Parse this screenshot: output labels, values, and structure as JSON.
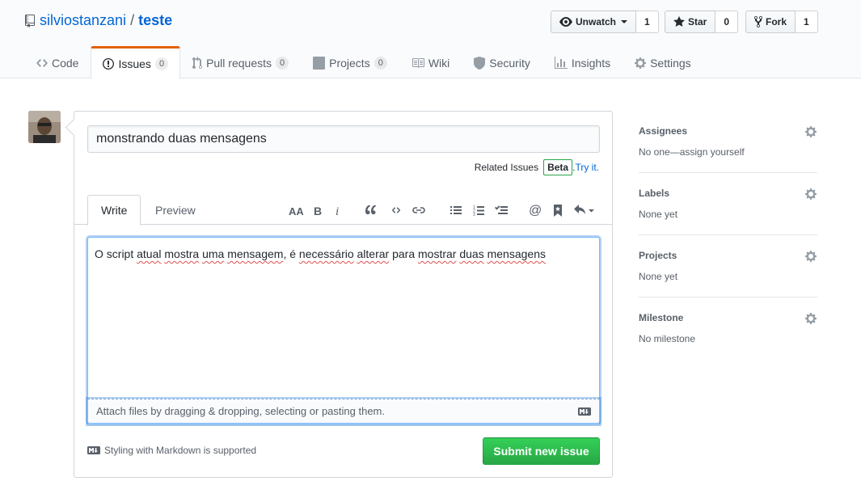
{
  "repo": {
    "owner": "silviostanzani",
    "separator": "/",
    "name": "teste"
  },
  "actions": {
    "watch": {
      "label": "Unwatch",
      "count": "1"
    },
    "star": {
      "label": "Star",
      "count": "0"
    },
    "fork": {
      "label": "Fork",
      "count": "1"
    }
  },
  "tabs": [
    {
      "label": "Code"
    },
    {
      "label": "Issues",
      "count": "0"
    },
    {
      "label": "Pull requests",
      "count": "0"
    },
    {
      "label": "Projects",
      "count": "0"
    },
    {
      "label": "Wiki"
    },
    {
      "label": "Security"
    },
    {
      "label": "Insights"
    },
    {
      "label": "Settings"
    }
  ],
  "form": {
    "title_value": "monstrando duas mensagens",
    "related_label": "Related Issues",
    "beta": "Beta",
    "dot": ".",
    "try_it": "Try it.",
    "write_tab": "Write",
    "preview_tab": "Preview",
    "body": [
      "O script ",
      "atual",
      " ",
      "mostra",
      " ",
      "uma",
      " ",
      "mensagem",
      ", é ",
      "necessário",
      " ",
      "alterar",
      " para ",
      "mostrar",
      " ",
      "duas",
      " ",
      "mensagens"
    ],
    "attach_hint": "Attach files by dragging & dropping, selecting or pasting them.",
    "markdown_note": "Styling with Markdown is supported",
    "submit": "Submit new issue"
  },
  "sidebar": [
    {
      "title": "Assignees",
      "value": "No one—assign yourself"
    },
    {
      "title": "Labels",
      "value": "None yet"
    },
    {
      "title": "Projects",
      "value": "None yet"
    },
    {
      "title": "Milestone",
      "value": "No milestone"
    }
  ],
  "colors": {
    "link": "#0366d6",
    "accent_tab": "#e36209",
    "submit_green": "#28a745"
  }
}
